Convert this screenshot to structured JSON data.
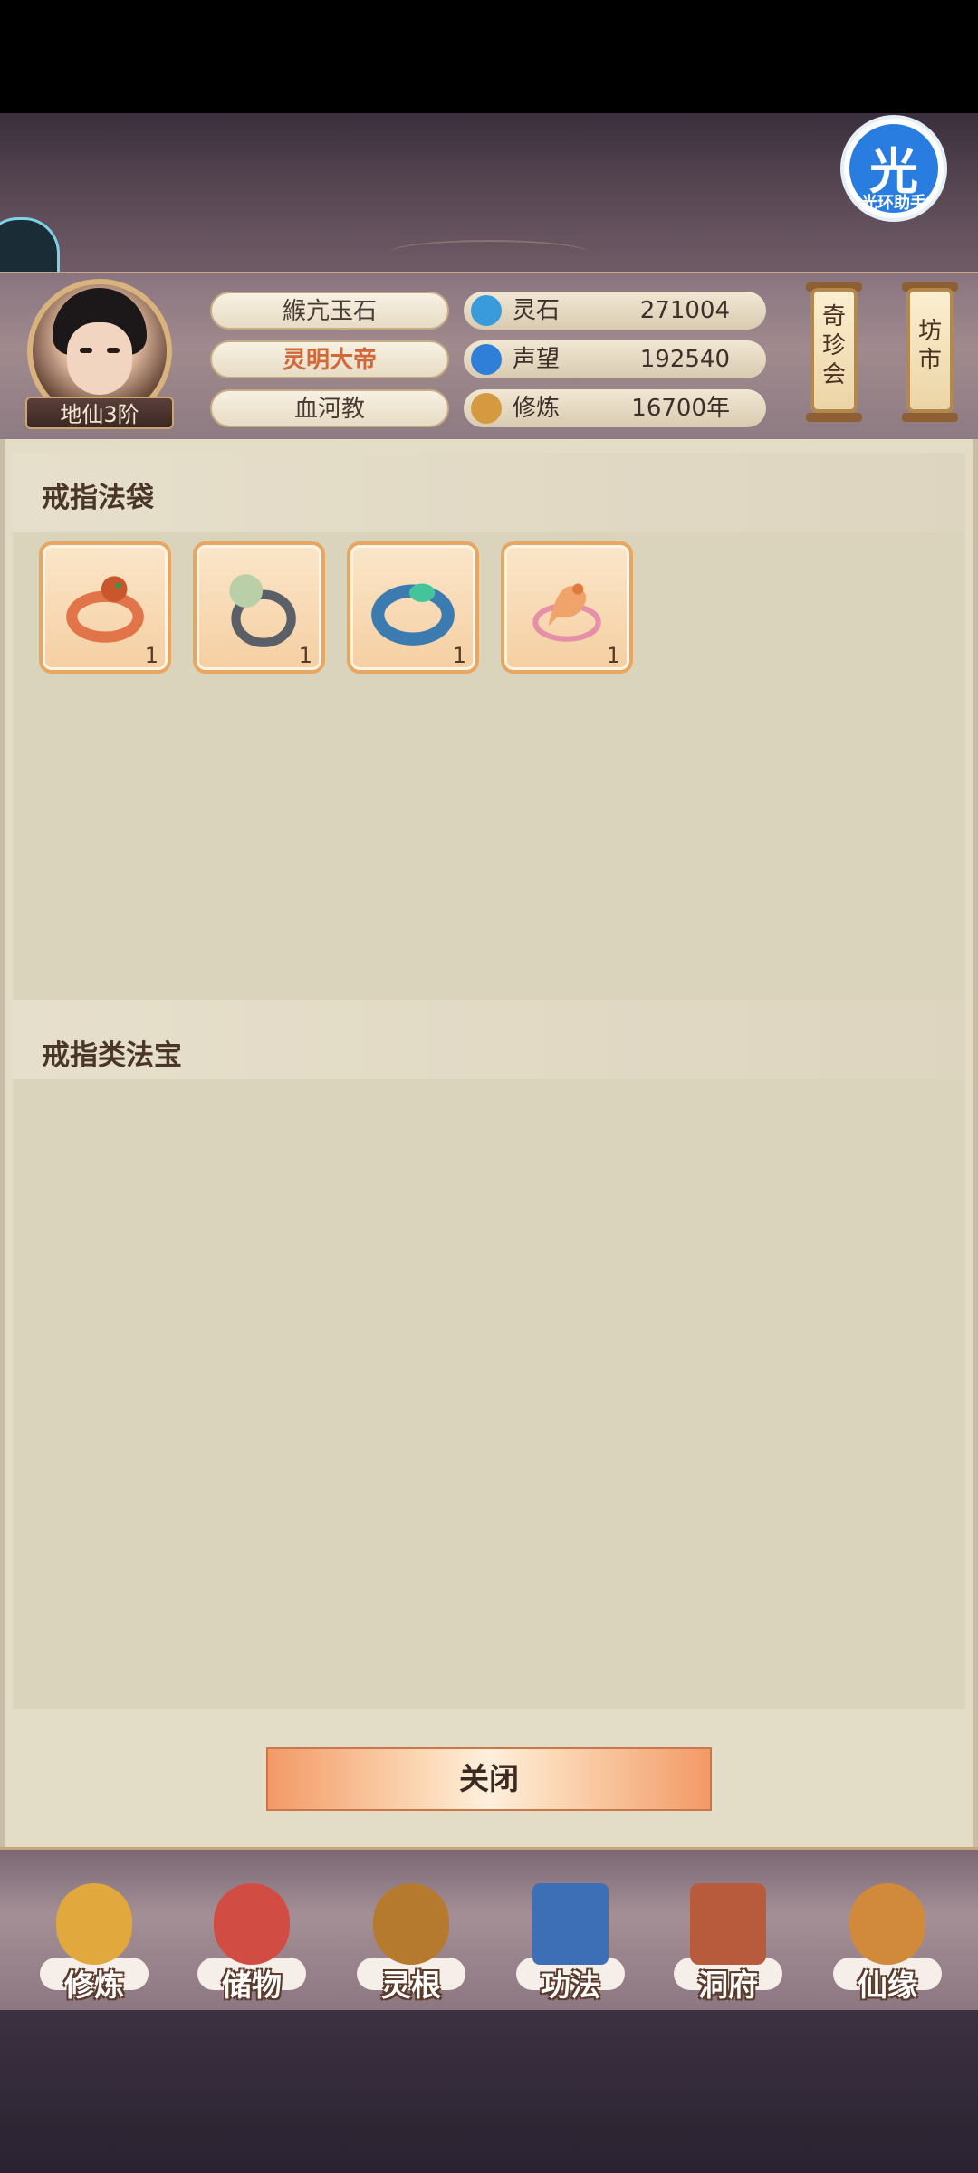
{
  "header": {
    "rank": "地仙3阶",
    "info": [
      "緱亢玉石",
      "灵明大帝",
      "血河教"
    ],
    "stats": [
      {
        "label": "灵石",
        "value": "271004",
        "icon": "spirit-stone-icon",
        "color": "#3a9bdc"
      },
      {
        "label": "声望",
        "value": "192540",
        "icon": "reputation-icon",
        "color": "#2f7fd8"
      },
      {
        "label": "修炼",
        "value": "16700年",
        "icon": "cultivation-icon",
        "color": "#d59a3f"
      }
    ],
    "buttons": [
      "奇珍会",
      "坊市"
    ]
  },
  "helper": {
    "char": "光",
    "label": "光环助手"
  },
  "sections": {
    "ring_bag": "戒指法袋",
    "ring_treasure": "戒指类法宝"
  },
  "items": [
    {
      "name": "serpent-ring",
      "count": "1",
      "color": "#e2744a"
    },
    {
      "name": "pearl-ring",
      "count": "1",
      "color": "#9fb9a0"
    },
    {
      "name": "jade-band-ring",
      "count": "1",
      "color": "#3c7bb0"
    },
    {
      "name": "dragon-ring",
      "count": "1",
      "color": "#f0a36a"
    }
  ],
  "close_label": "关闭",
  "nav": [
    {
      "label": "修炼",
      "icon": "cultivate-icon",
      "color": "#e1a93d"
    },
    {
      "label": "储物",
      "icon": "storage-bag-icon",
      "color": "#d14d43"
    },
    {
      "label": "灵根",
      "icon": "spirit-root-icon",
      "color": "#b57a2e"
    },
    {
      "label": "功法",
      "icon": "skill-book-icon",
      "color": "#3d6fb6"
    },
    {
      "label": "洞府",
      "icon": "cave-house-icon",
      "color": "#b85b3c"
    },
    {
      "label": "仙缘",
      "icon": "gourd-icon",
      "color": "#d18a3c"
    }
  ]
}
